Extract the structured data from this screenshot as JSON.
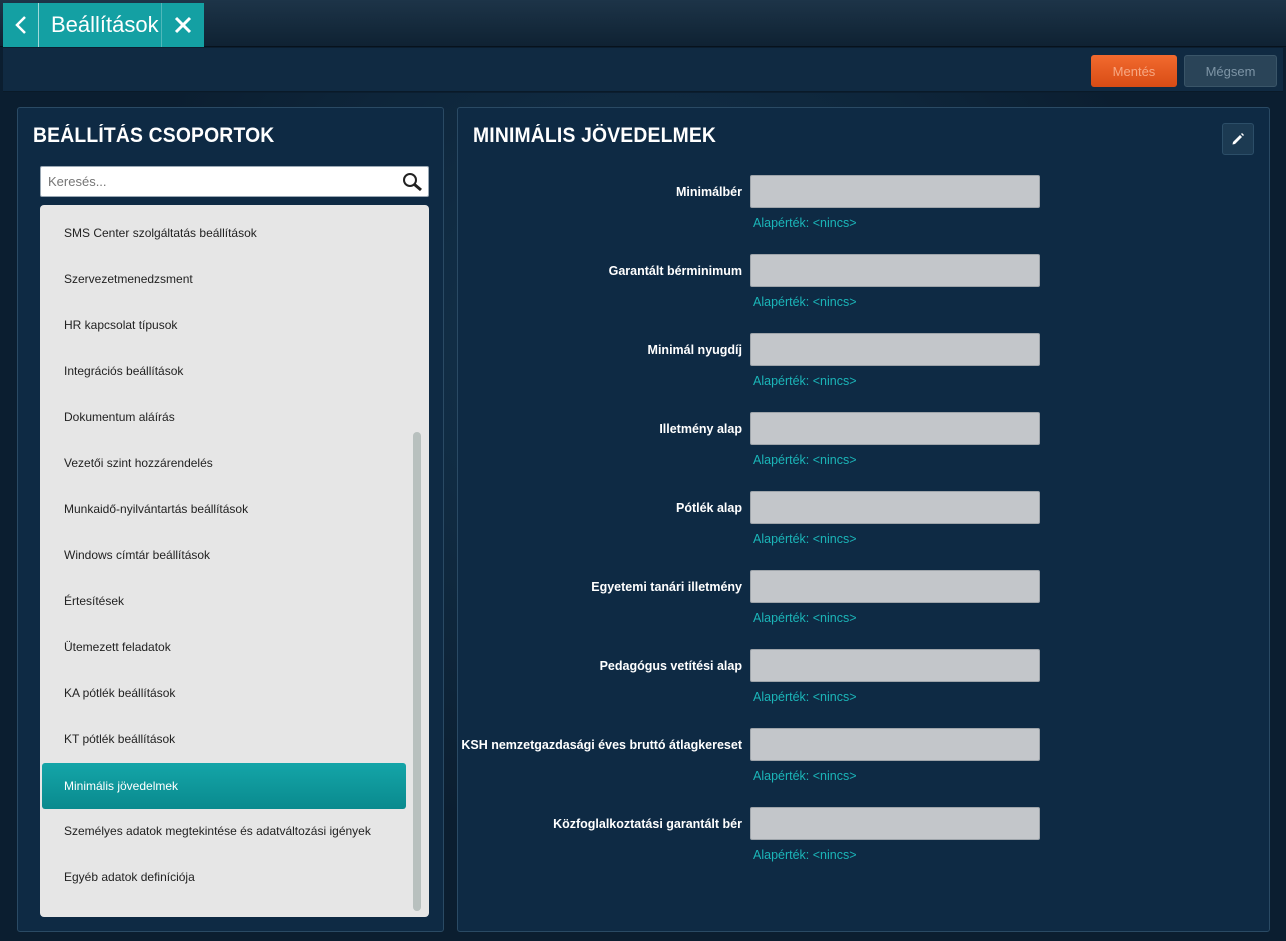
{
  "window": {
    "tab_title": "Beállítások"
  },
  "toolbar": {
    "save_label": "Mentés",
    "cancel_label": "Mégsem"
  },
  "left_panel": {
    "title": "BEÁLLÍTÁS CSOPORTOK",
    "search_placeholder": "Keresés...",
    "items": [
      {
        "label": "SMS Center szolgáltatás beállítások"
      },
      {
        "label": "Szervezetmenedzsment"
      },
      {
        "label": "HR kapcsolat típusok"
      },
      {
        "label": "Integrációs beállítások"
      },
      {
        "label": "Dokumentum aláírás"
      },
      {
        "label": "Vezetői szint hozzárendelés"
      },
      {
        "label": "Munkaidő-nyilvántartás beállítások"
      },
      {
        "label": "Windows címtár beállítások"
      },
      {
        "label": "Értesítések"
      },
      {
        "label": "Ütemezett feladatok"
      },
      {
        "label": "KA pótlék beállítások"
      },
      {
        "label": "KT pótlék beállítások"
      },
      {
        "label": "Minimális jövedelmek"
      },
      {
        "label": "Személyes adatok megtekintése és adatváltozási igények"
      },
      {
        "label": "Egyéb adatok definíciója"
      }
    ],
    "selected": "Minimális jövedelmek"
  },
  "right_panel": {
    "title": "MINIMÁLIS JÖVEDELMEK",
    "fields": [
      {
        "label": "Minimálbér",
        "value": "",
        "default": "Alapérték: <nincs>"
      },
      {
        "label": "Garantált bérminimum",
        "value": "",
        "default": "Alapérték: <nincs>"
      },
      {
        "label": "Minimál nyugdíj",
        "value": "",
        "default": "Alapérték: <nincs>"
      },
      {
        "label": "Illetmény alap",
        "value": "",
        "default": "Alapérték: <nincs>"
      },
      {
        "label": "Pótlék alap",
        "value": "",
        "default": "Alapérték: <nincs>"
      },
      {
        "label": "Egyetemi tanári illetmény",
        "value": "",
        "default": "Alapérték: <nincs>"
      },
      {
        "label": "Pedagógus vetítési alap",
        "value": "",
        "default": "Alapérték: <nincs>"
      },
      {
        "label": "KSH nemzetgazdasági éves bruttó átlagkereset",
        "value": "",
        "default": "Alapérték: <nincs>"
      },
      {
        "label": "Közfoglalkoztatási garantált bér",
        "value": "",
        "default": "Alapérték: <nincs>"
      }
    ]
  },
  "colors": {
    "accent": "#14a0a3",
    "save": "#e85a20",
    "default_text": "#1bb5b8"
  }
}
